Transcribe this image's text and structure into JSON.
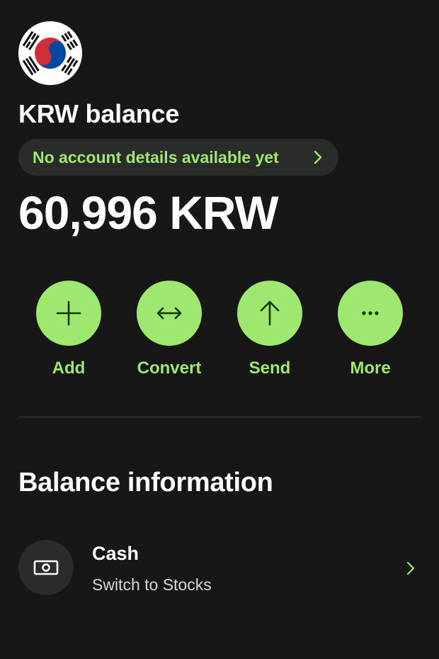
{
  "balance": {
    "currency_title": "KRW balance",
    "account_details_text": "No account details available yet",
    "amount": "60,996 KRW"
  },
  "actions": [
    {
      "label": "Add",
      "icon": "plus-icon"
    },
    {
      "label": "Convert",
      "icon": "convert-arrows-icon"
    },
    {
      "label": "Send",
      "icon": "arrow-up-icon"
    },
    {
      "label": "More",
      "icon": "more-dots-icon"
    }
  ],
  "info_section": {
    "title": "Balance information",
    "row": {
      "title": "Cash",
      "subtitle": "Switch to Stocks",
      "icon": "banknote-icon"
    }
  },
  "colors": {
    "background": "#161716",
    "accent_green": "#9fe870",
    "pill_bg": "#2a2c2a",
    "text_primary": "#ffffff"
  },
  "flag_icon": "south-korea-flag-icon"
}
